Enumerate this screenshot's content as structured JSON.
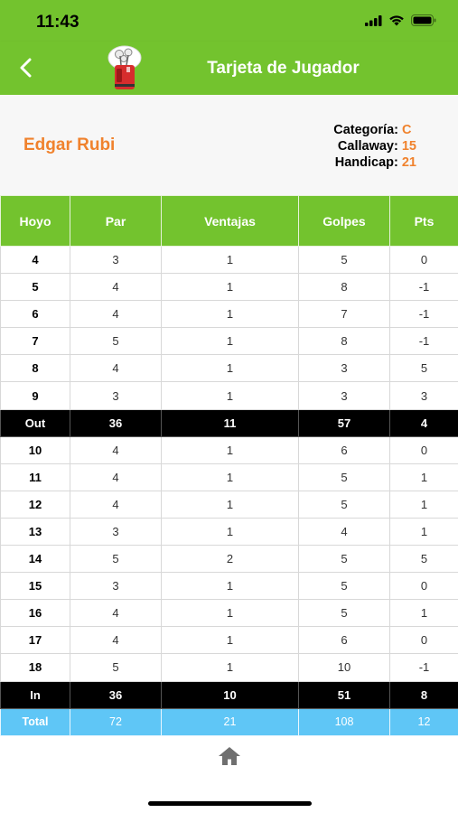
{
  "status_bar": {
    "time": "11:43"
  },
  "nav": {
    "title": "Tarjeta de Jugador"
  },
  "player": {
    "name": "Edgar Rubi",
    "stats": [
      {
        "label": "Categoría:",
        "value": "C"
      },
      {
        "label": "Callaway:",
        "value": "15"
      },
      {
        "label": "Handicap:",
        "value": "21"
      }
    ]
  },
  "table": {
    "headers": [
      "Hoyo",
      "Par",
      "Ventajas",
      "Golpes",
      "Pts"
    ],
    "rows": [
      {
        "type": "hole",
        "cells": [
          "4",
          "3",
          "1",
          "5",
          "0"
        ]
      },
      {
        "type": "hole",
        "cells": [
          "5",
          "4",
          "1",
          "8",
          "-1"
        ]
      },
      {
        "type": "hole",
        "cells": [
          "6",
          "4",
          "1",
          "7",
          "-1"
        ]
      },
      {
        "type": "hole",
        "cells": [
          "7",
          "5",
          "1",
          "8",
          "-1"
        ]
      },
      {
        "type": "hole",
        "cells": [
          "8",
          "4",
          "1",
          "3",
          "5"
        ]
      },
      {
        "type": "hole",
        "cells": [
          "9",
          "3",
          "1",
          "3",
          "3"
        ]
      },
      {
        "type": "sum",
        "cells": [
          "Out",
          "36",
          "11",
          "57",
          "4"
        ]
      },
      {
        "type": "hole",
        "cells": [
          "10",
          "4",
          "1",
          "6",
          "0"
        ]
      },
      {
        "type": "hole",
        "cells": [
          "11",
          "4",
          "1",
          "5",
          "1"
        ]
      },
      {
        "type": "hole",
        "cells": [
          "12",
          "4",
          "1",
          "5",
          "1"
        ]
      },
      {
        "type": "hole",
        "cells": [
          "13",
          "3",
          "1",
          "4",
          "1"
        ]
      },
      {
        "type": "hole",
        "cells": [
          "14",
          "5",
          "2",
          "5",
          "5"
        ]
      },
      {
        "type": "hole",
        "cells": [
          "15",
          "3",
          "1",
          "5",
          "0"
        ]
      },
      {
        "type": "hole",
        "cells": [
          "16",
          "4",
          "1",
          "5",
          "1"
        ]
      },
      {
        "type": "hole",
        "cells": [
          "17",
          "4",
          "1",
          "6",
          "0"
        ]
      },
      {
        "type": "hole",
        "cells": [
          "18",
          "5",
          "1",
          "10",
          "-1"
        ]
      },
      {
        "type": "sum",
        "cells": [
          "In",
          "36",
          "10",
          "51",
          "8"
        ]
      },
      {
        "type": "total",
        "cells": [
          "Total",
          "72",
          "21",
          "108",
          "12"
        ]
      }
    ]
  },
  "colors": {
    "brand_green": "#73c32e",
    "accent_orange": "#f0822d",
    "total_blue": "#5fc6f6",
    "subtotal_black": "#000000"
  },
  "icons": {
    "back": "chevron-left-icon",
    "logo": "golf-bag-logo",
    "home": "home-icon"
  }
}
